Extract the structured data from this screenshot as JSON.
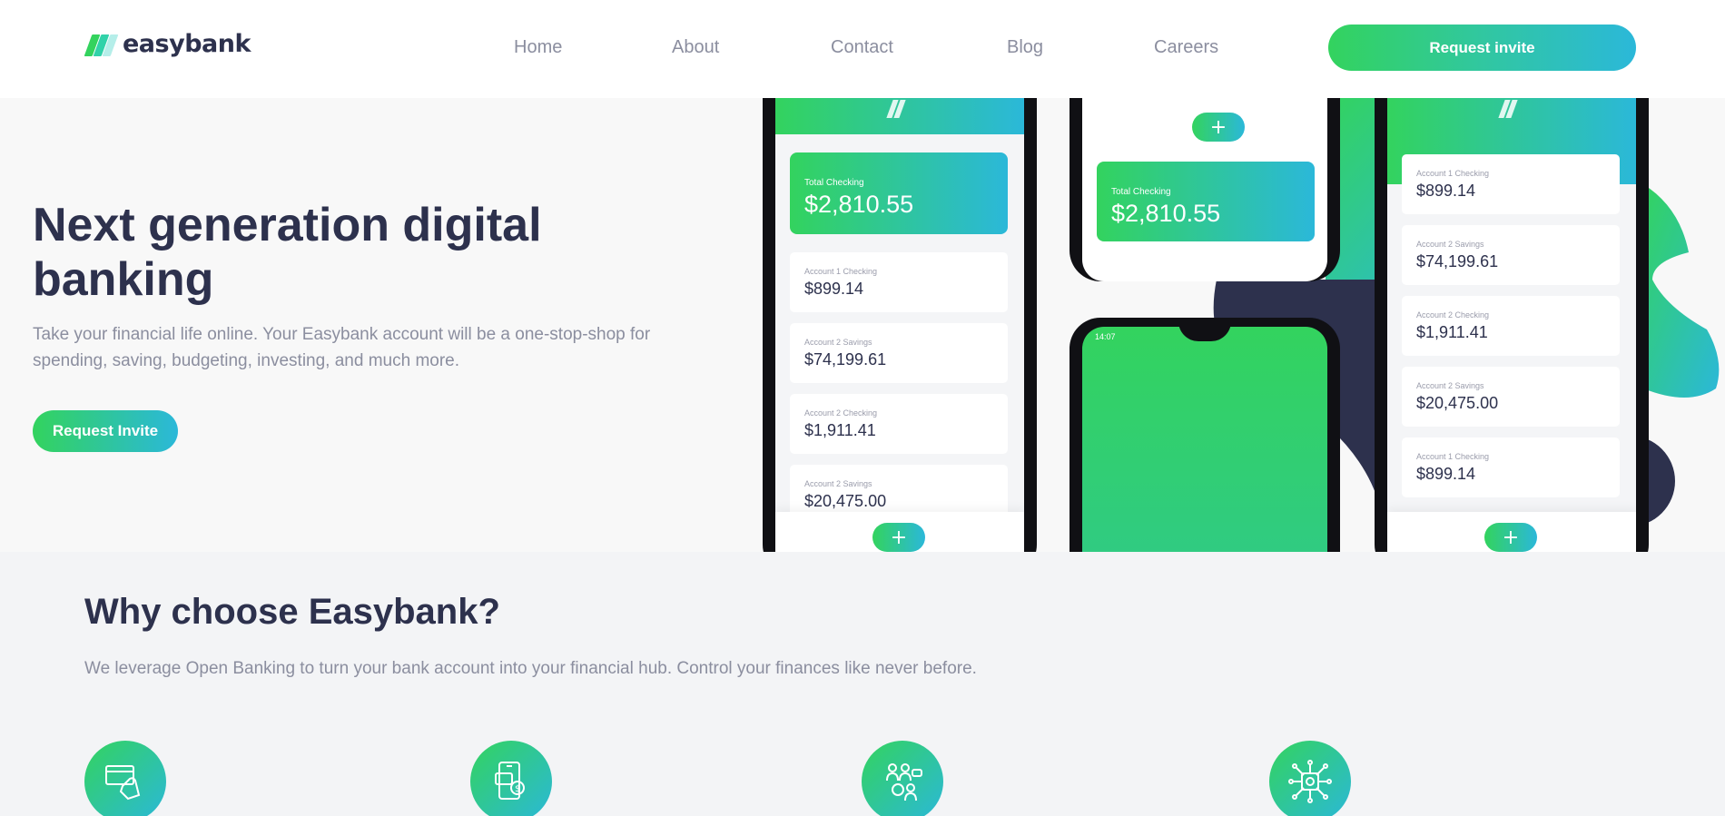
{
  "brand": {
    "name": "easybank"
  },
  "nav": {
    "items": [
      {
        "label": "Home"
      },
      {
        "label": "About"
      },
      {
        "label": "Contact"
      },
      {
        "label": "Blog"
      },
      {
        "label": "Careers"
      }
    ],
    "cta_label": "Request invite"
  },
  "hero": {
    "title": "Next generation digital banking",
    "description": "Take your financial life online. Your Easybank account will be a one-stop-shop for spending, saving, budgeting, investing, and much more.",
    "cta_label": "Request Invite"
  },
  "mockup": {
    "phone_left": {
      "total_label": "Total Checking",
      "total_value": "$2,810.55",
      "accounts": [
        {
          "label": "Account 1 Checking",
          "value": "$899.14"
        },
        {
          "label": "Account 2 Savings",
          "value": "$74,199.61"
        },
        {
          "label": "Account 2 Checking",
          "value": "$1,911.41"
        },
        {
          "label": "Account 2 Savings",
          "value": "$20,475.00"
        }
      ]
    },
    "phone_mid_top": {
      "total_label": "Total Checking",
      "total_value": "$2,810.55"
    },
    "phone_mid_bottom": {
      "time": "14:07"
    },
    "phone_right": {
      "accounts": [
        {
          "label": "Account 1 Checking",
          "value": "$899.14"
        },
        {
          "label": "Account 2 Savings",
          "value": "$74,199.61"
        },
        {
          "label": "Account 2 Checking",
          "value": "$1,911.41"
        },
        {
          "label": "Account 2 Savings",
          "value": "$20,475.00"
        },
        {
          "label": "Account 1 Checking",
          "value": "$899.14"
        }
      ]
    }
  },
  "features": {
    "title": "Why choose Easybank?",
    "description": "We leverage Open Banking to turn your bank account into your financial hub. Control your finances like never before.",
    "icons": [
      "online-banking-icon",
      "budgeting-icon",
      "onboarding-icon",
      "open-api-icon"
    ]
  },
  "colors": {
    "accent_green": "#33d35e",
    "accent_cyan": "#2bb8d9",
    "dark_blue": "#2d314d",
    "grayish_blue": "#8b8e9f"
  }
}
